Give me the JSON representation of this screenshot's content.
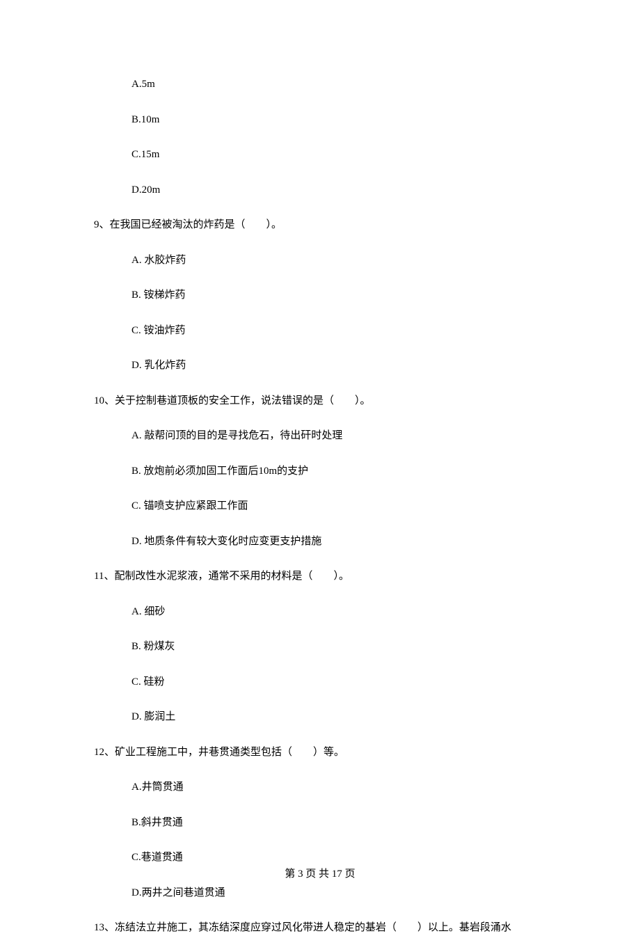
{
  "q8": {
    "optA": "A.5m",
    "optB": "B.10m",
    "optC": "C.15m",
    "optD": "D.20m"
  },
  "q9": {
    "stem": "9、在我国已经被淘汰的炸药是（　　）。",
    "optA": "A.  水胶炸药",
    "optB": "B.  铵梯炸药",
    "optC": "C.  铵油炸药",
    "optD": "D.  乳化炸药"
  },
  "q10": {
    "stem": "10、关于控制巷道顶板的安全工作，说法错误的是（　　）。",
    "optA": "A.  敲帮问顶的目的是寻找危石，待出矸时处理",
    "optB": "B.  放炮前必须加固工作面后10m的支护",
    "optC": "C.  锚喷支护应紧跟工作面",
    "optD": "D.  地质条件有较大变化时应变更支护措施"
  },
  "q11": {
    "stem": "11、配制改性水泥浆液，通常不采用的材料是（　　）。",
    "optA": "A.  细砂",
    "optB": "B.  粉煤灰",
    "optC": "C.  硅粉",
    "optD": "D.  膨润土"
  },
  "q12": {
    "stem": "12、矿业工程施工中，井巷贯通类型包括（　　）等。",
    "optA": "A.井筒贯通",
    "optB": "B.斜井贯通",
    "optC": "C.巷道贯通",
    "optD": "D.两井之间巷道贯通"
  },
  "q13": {
    "stem": "13、冻结法立井施工，其冻结深度应穿过风化带进人稳定的基岩（　　）以上。基岩段涌水"
  },
  "footer": "第 3 页 共 17 页"
}
